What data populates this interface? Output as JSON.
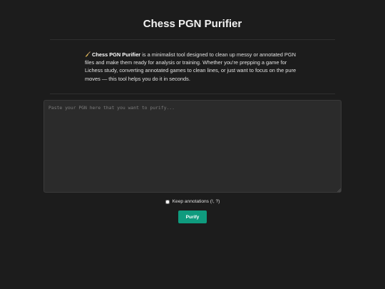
{
  "header": {
    "title": "Chess PGN Purifier"
  },
  "intro": {
    "icon": "broom-icon",
    "brand": "Chess PGN Purifier",
    "text": " is a minimalist tool designed to clean up messy or annotated PGN files and make them ready for analysis or training. Whether you're prepping a game for Lichess study, converting annotated games to clean lines, or just want to focus on the pure moves — this tool helps you do it in seconds."
  },
  "editor": {
    "placeholder": "Paste your PGN here that you want to purify...",
    "value": ""
  },
  "options": {
    "keep_annotations_label": "Keep annotations (!, ?)",
    "keep_annotations_checked": false
  },
  "actions": {
    "purify_label": "Purify"
  },
  "colors": {
    "background": "#1c1c1c",
    "accent": "#0f9b7e"
  }
}
